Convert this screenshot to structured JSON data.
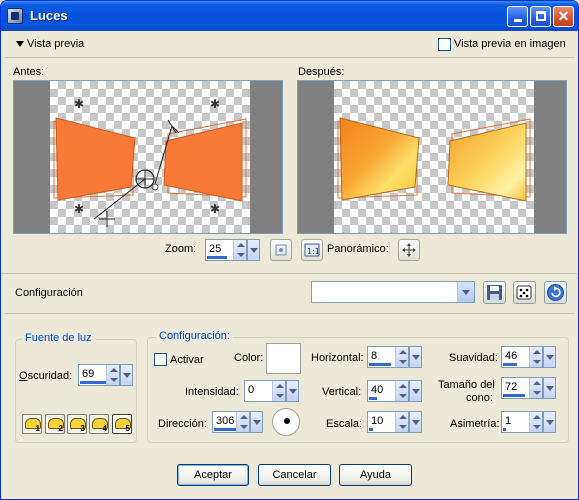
{
  "window": {
    "title": "Luces"
  },
  "preview": {
    "toggle_label": "Vista previa",
    "image_checkbox_label": "Vista previa en imagen",
    "image_checked": false
  },
  "panes": {
    "before_label": "Antes:",
    "after_label": "Después:"
  },
  "zoom": {
    "label": "Zoom:",
    "value": "25",
    "pan_label": "Panorámico:"
  },
  "config_bar": {
    "label": "Configuración",
    "preset_value": ""
  },
  "light_source": {
    "title": "Fuente de luz",
    "darkness_label": "Oscuridad:",
    "darkness_value": "69",
    "lights": [
      "1",
      "2",
      "3",
      "4",
      "5"
    ]
  },
  "settings": {
    "title": "Configuración:",
    "activate_label": "Activar",
    "activate_checked": false,
    "color_label": "Color:",
    "color_value": "#ffffff",
    "intensity_label": "Intensidad:",
    "intensity_value": "0",
    "direction_label": "Dirección:",
    "direction_value": "306",
    "horizontal_label": "Horizontal:",
    "horizontal_value": "8",
    "vertical_label": "Vertical:",
    "vertical_value": "40",
    "scale_label": "Escala:",
    "scale_value": "10",
    "softness_label": "Suavidad:",
    "softness_value": "46",
    "cone_label_1": "Tamaño del",
    "cone_label_2": "cono:",
    "cone_value": "72",
    "asymmetry_label": "Asimetría:",
    "asymmetry_value": "1"
  },
  "buttons": {
    "ok": "Aceptar",
    "cancel": "Cancelar",
    "help": "Ayuda"
  }
}
